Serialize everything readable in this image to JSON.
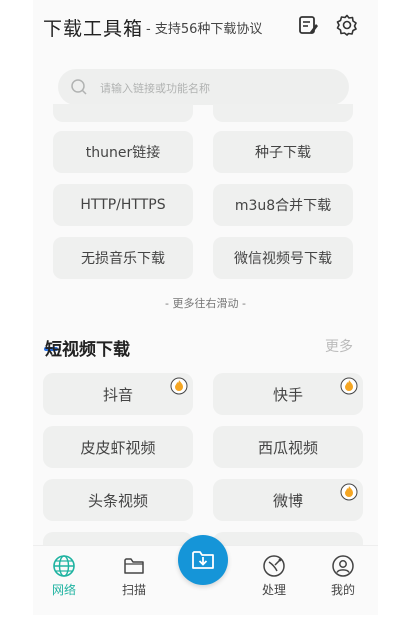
{
  "header": {
    "title": "下载工具箱",
    "subtitle": "- 支持56种下载协议",
    "icons": [
      "notes-icon",
      "settings-gear-icon"
    ]
  },
  "search": {
    "placeholder": "请输入链接或功能名称"
  },
  "protocols": [
    {
      "label": "thuner链接"
    },
    {
      "label": "种子下载"
    },
    {
      "label": "HTTP/HTTPS"
    },
    {
      "label": "m3u8合并下载"
    },
    {
      "label": "无损音乐下载"
    },
    {
      "label": "微信视频号下载"
    }
  ],
  "more_hint": "- 更多往右滑动 -",
  "short_video": {
    "title": "短视频下载",
    "more": "更多",
    "items": [
      {
        "label": "抖音",
        "hot": true
      },
      {
        "label": "快手",
        "hot": true
      },
      {
        "label": "皮皮虾视频",
        "hot": false
      },
      {
        "label": "西瓜视频",
        "hot": false
      },
      {
        "label": "头条视频",
        "hot": false
      },
      {
        "label": "微博",
        "hot": true
      }
    ]
  },
  "nav": {
    "items": [
      {
        "label": "网络",
        "icon": "globe-icon",
        "active": true
      },
      {
        "label": "扫描",
        "icon": "folder-icon",
        "active": false
      },
      {
        "label": "处理",
        "icon": "satellite-icon",
        "active": false
      },
      {
        "label": "我的",
        "icon": "user-icon",
        "active": false
      }
    ],
    "center_icon": "download-folder-icon"
  },
  "colors": {
    "accent": "#1fb3a1",
    "primary_blue": "#1595d8",
    "fire": "#f5a623"
  }
}
